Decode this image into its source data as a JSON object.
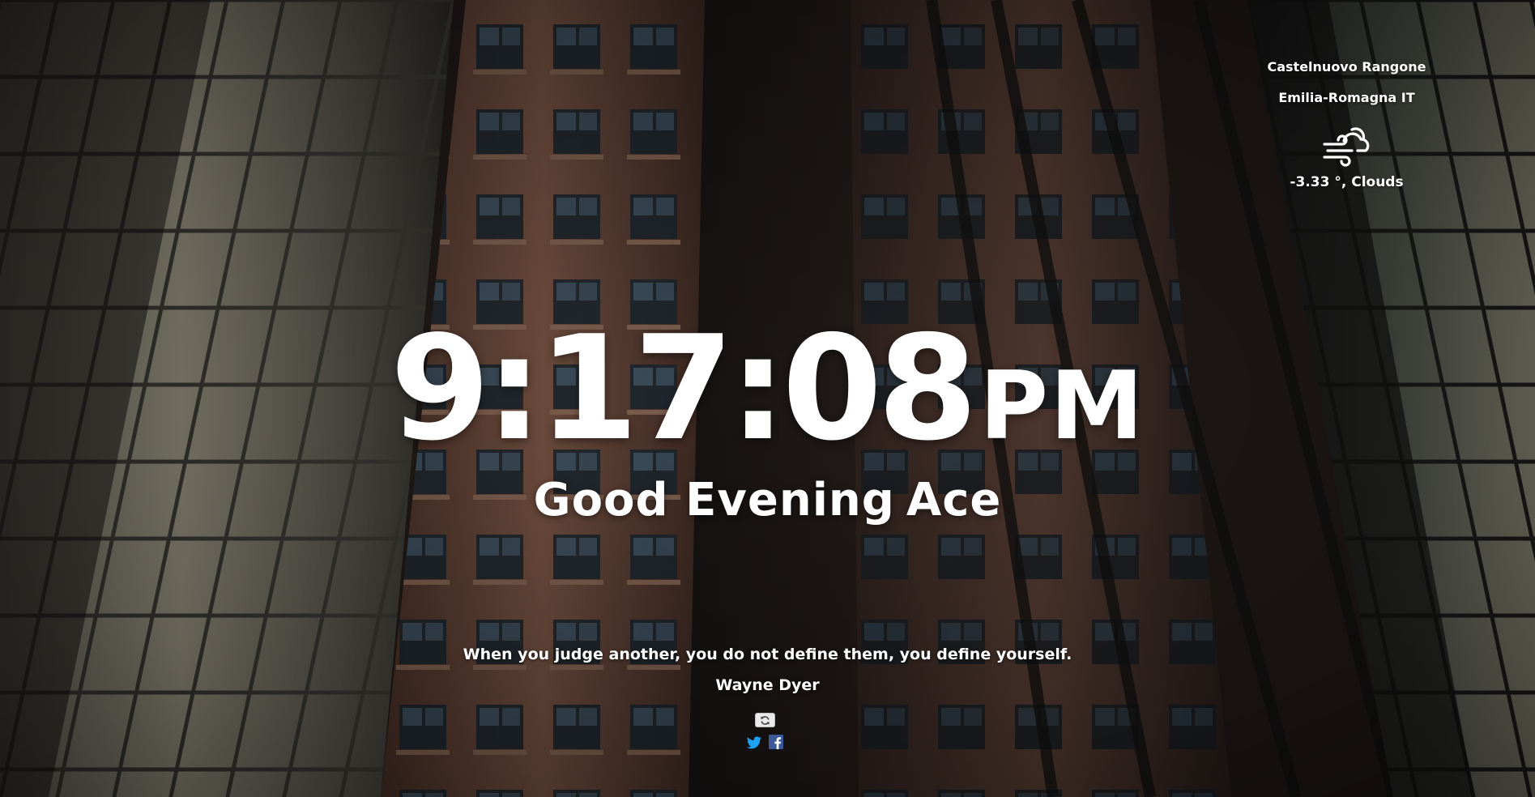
{
  "weather": {
    "city": "Castelnuovo Rangone",
    "region": "Emilia-Romagna IT",
    "icon": "wind-cloud-icon",
    "temperature": "-3.33",
    "unit": "°",
    "separator": ",",
    "condition": "Clouds"
  },
  "clock": {
    "time": "9:17:08",
    "meridiem": "PM"
  },
  "greeting": {
    "salutation": "Good Evening",
    "name": "Ace"
  },
  "quote": {
    "text": "When you judge another, you do not define them, you define yourself.",
    "author": "Wayne Dyer"
  },
  "actions": {
    "refresh_icon": "refresh-icon",
    "twitter_icon": "twitter-icon",
    "facebook_icon": "facebook-icon"
  },
  "colors": {
    "text": "#ffffff",
    "twitter": "#1da1f2",
    "facebook": "#3b5998"
  }
}
